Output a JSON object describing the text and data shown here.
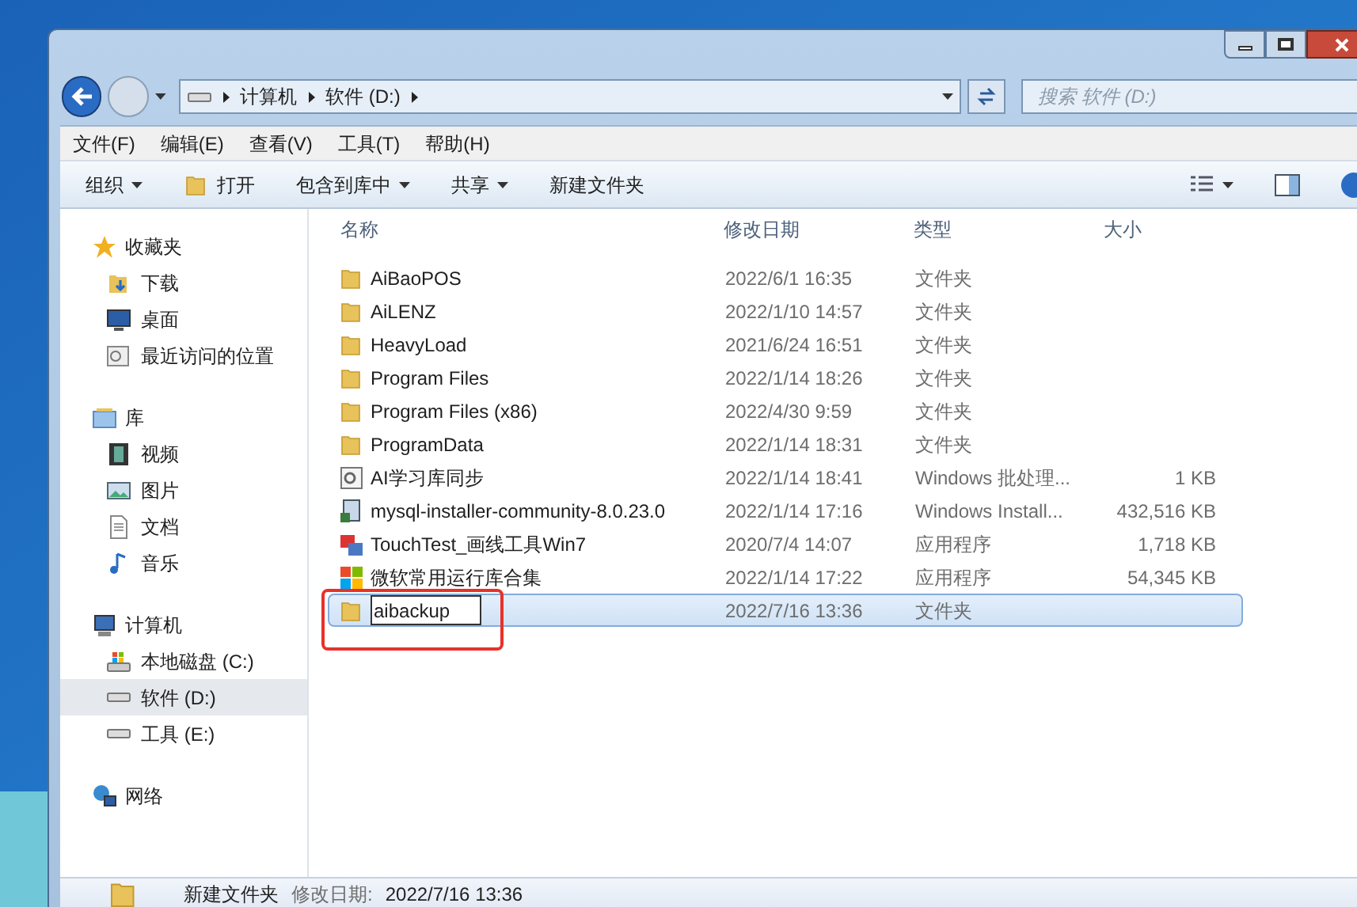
{
  "address": {
    "crumbs": [
      "计算机",
      "软件 (D:)"
    ]
  },
  "search": {
    "placeholder": "搜索 软件 (D:)"
  },
  "menu": [
    "文件(F)",
    "编辑(E)",
    "查看(V)",
    "工具(T)",
    "帮助(H)"
  ],
  "toolbar": [
    {
      "label": "组织",
      "kind": "dropdown"
    },
    {
      "label": "打开",
      "kind": "open"
    },
    {
      "label": "包含到库中",
      "kind": "dropdown"
    },
    {
      "label": "共享",
      "kind": "dropdown"
    },
    {
      "label": "新建文件夹",
      "kind": "plain"
    }
  ],
  "sidebar": [
    {
      "label": "收藏夹",
      "children": [
        {
          "label": "下载",
          "selected": false
        },
        {
          "label": "桌面",
          "selected": false
        },
        {
          "label": "最近访问的位置",
          "selected": false
        }
      ]
    },
    {
      "label": "库",
      "children": [
        {
          "label": "视频",
          "selected": false
        },
        {
          "label": "图片",
          "selected": false
        },
        {
          "label": "文档",
          "selected": false
        },
        {
          "label": "音乐",
          "selected": false
        }
      ]
    },
    {
      "label": "计算机",
      "children": [
        {
          "label": "本地磁盘 (C:)",
          "selected": false
        },
        {
          "label": "软件 (D:)",
          "selected": true
        },
        {
          "label": "工具 (E:)",
          "selected": false
        }
      ]
    },
    {
      "label": "网络"
    }
  ],
  "columns": [
    "名称",
    "修改日期",
    "类型",
    "大小"
  ],
  "rows": [
    {
      "kind": "folder",
      "name": "AiBaoPOS",
      "date": "2022/6/1 16:35",
      "type": "文件夹",
      "selected": false,
      "renaming": false,
      "marked": false
    },
    {
      "kind": "folder",
      "name": "AiLENZ",
      "date": "2022/1/10 14:57",
      "type": "文件夹",
      "selected": false,
      "renaming": false,
      "marked": false
    },
    {
      "kind": "folder",
      "name": "HeavyLoad",
      "date": "2021/6/24 16:51",
      "type": "文件夹",
      "selected": false,
      "renaming": false,
      "marked": false
    },
    {
      "kind": "folder",
      "name": "Program Files",
      "date": "2022/1/14 18:26",
      "type": "文件夹",
      "selected": false,
      "renaming": false,
      "marked": false
    },
    {
      "kind": "folder",
      "name": "Program Files (x86)",
      "date": "2022/4/30 9:59",
      "type": "文件夹",
      "selected": false,
      "renaming": false,
      "marked": false
    },
    {
      "kind": "folder",
      "name": "ProgramData",
      "date": "2022/1/14 18:31",
      "type": "文件夹",
      "selected": false,
      "renaming": false,
      "marked": false
    },
    {
      "kind": "batch",
      "name": "AI学习库同步",
      "date": "2022/1/14 18:41",
      "type": "Windows 批处理...",
      "size": "1 KB",
      "selected": false,
      "renaming": false,
      "marked": false
    },
    {
      "kind": "installer",
      "name": "mysql-installer-community-8.0.23.0",
      "date": "2022/1/14 17:16",
      "type": "Windows Install...",
      "size": "432,516 KB",
      "selected": false,
      "renaming": false,
      "marked": false
    },
    {
      "kind": "app",
      "name": "TouchTest_画线工具Win7",
      "date": "2020/7/4 14:07",
      "type": "应用程序",
      "size": "1,718 KB",
      "selected": false,
      "renaming": false,
      "marked": false
    },
    {
      "kind": "tiles",
      "name": "微软常用运行库合集",
      "date": "2022/1/14 17:22",
      "type": "应用程序",
      "size": "54,345 KB",
      "selected": false,
      "renaming": false,
      "marked": false
    },
    {
      "kind": "folder",
      "name": "aibackup",
      "date": "2022/7/16 13:36",
      "type": "文件夹",
      "selected": true,
      "renaming": true,
      "marked": true
    }
  ],
  "status": {
    "name": "新建文件夹",
    "label": "修改日期:",
    "value": "2022/7/16 13:36"
  }
}
